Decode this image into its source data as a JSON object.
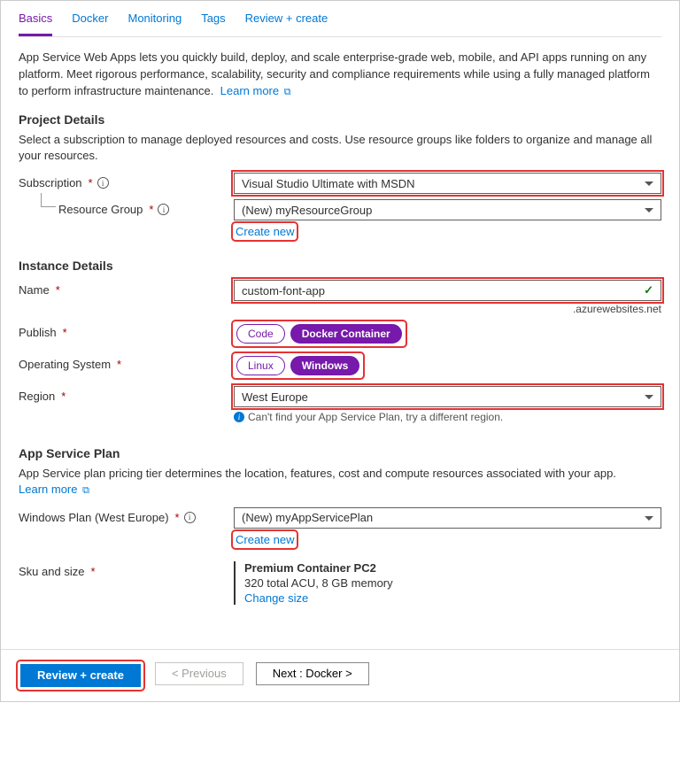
{
  "tabs": [
    "Basics",
    "Docker",
    "Monitoring",
    "Tags",
    "Review + create"
  ],
  "intro": "App Service Web Apps lets you quickly build, deploy, and scale enterprise-grade web, mobile, and API apps running on any platform. Meet rigorous performance, scalability, security and compliance requirements while using a fully managed platform to perform infrastructure maintenance.",
  "learnMore": "Learn more",
  "project": {
    "heading": "Project Details",
    "sub": "Select a subscription to manage deployed resources and costs. Use resource groups like folders to organize and manage all your resources.",
    "subscriptionLabel": "Subscription",
    "subscriptionValue": "Visual Studio Ultimate with MSDN",
    "rgLabel": "Resource Group",
    "rgValue": "(New) myResourceGroup",
    "createNew": "Create new"
  },
  "instance": {
    "heading": "Instance Details",
    "nameLabel": "Name",
    "nameValue": "custom-font-app",
    "suffix": ".azurewebsites.net",
    "publishLabel": "Publish",
    "publishOptions": [
      "Code",
      "Docker Container"
    ],
    "osLabel": "Operating System",
    "osOptions": [
      "Linux",
      "Windows"
    ],
    "regionLabel": "Region",
    "regionValue": "West Europe",
    "regionHint": "Can't find your App Service Plan, try a different region."
  },
  "plan": {
    "heading": "App Service Plan",
    "sub": "App Service plan pricing tier determines the location, features, cost and compute resources associated with your app.",
    "learnMore": "Learn more",
    "planLabel": "Windows Plan (West Europe)",
    "planValue": "(New) myAppServicePlan",
    "createNew": "Create new",
    "skuLabel": "Sku and size",
    "skuTitle": "Premium Container PC2",
    "skuSub": "320 total ACU, 8 GB memory",
    "changeSize": "Change size"
  },
  "footer": {
    "review": "Review + create",
    "prev": "< Previous",
    "next": "Next : Docker >"
  }
}
